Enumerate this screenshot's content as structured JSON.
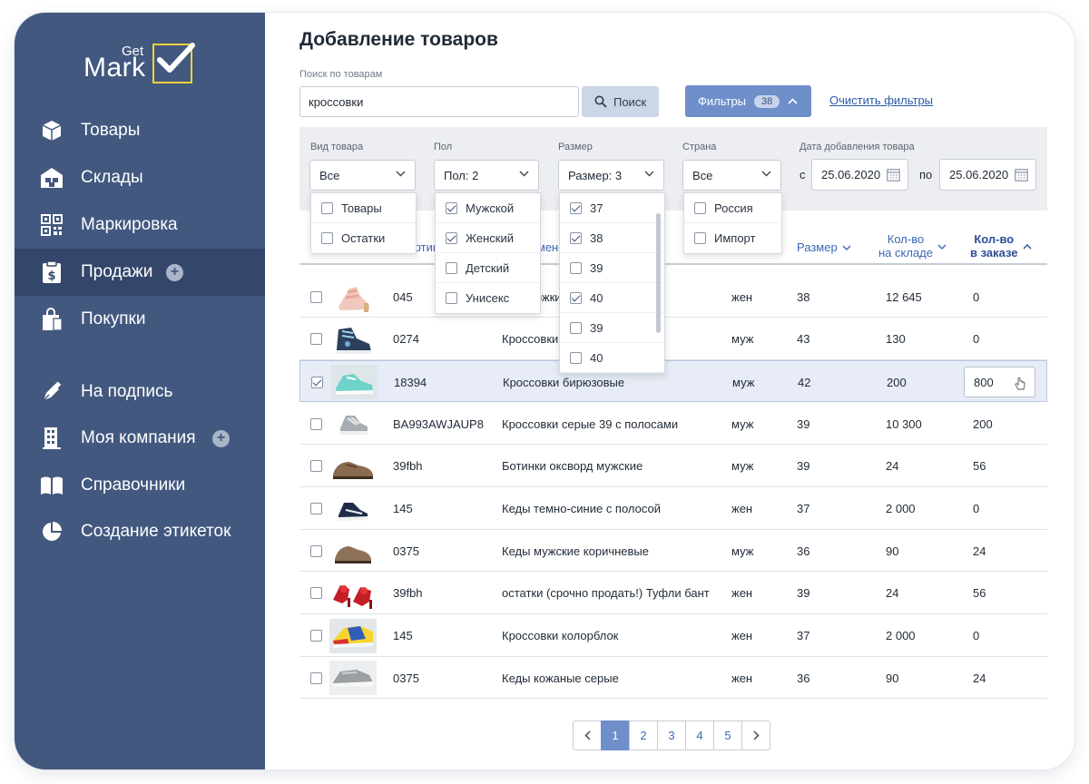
{
  "logo": {
    "get": "Get",
    "mark": "Mark"
  },
  "sidebar": {
    "items": [
      {
        "label": "Товары",
        "icon": "box-icon"
      },
      {
        "label": "Склады",
        "icon": "warehouse-icon"
      },
      {
        "label": "Маркировка",
        "icon": "qr-code-icon"
      },
      {
        "label": "Продажи",
        "icon": "receipt-dollar-icon",
        "active": true,
        "plus": "+"
      },
      {
        "label": "Покупки",
        "icon": "shopping-bag-icon"
      },
      {
        "label": "На подпись",
        "icon": "pen-icon"
      },
      {
        "label": "Моя компания",
        "icon": "building-icon",
        "plus": "+"
      },
      {
        "label": "Справочники",
        "icon": "book-icon"
      },
      {
        "label": "Создание этикеток",
        "icon": "pie-chart-icon"
      }
    ]
  },
  "page": {
    "title": "Добавление товаров"
  },
  "search": {
    "label": "Поиск по товарам",
    "value": "кроссовки",
    "button": "Поиск"
  },
  "filters": {
    "button": "Фильтры",
    "count": "38",
    "clear": "Очистить фильтры",
    "type": {
      "label": "Вид товара",
      "value": "Все",
      "options": [
        {
          "label": "Товары",
          "checked": false
        },
        {
          "label": "Остатки",
          "checked": false
        }
      ]
    },
    "gender": {
      "label": "Пол",
      "value": "Пол: 2",
      "options": [
        {
          "label": "Мужской",
          "checked": true
        },
        {
          "label": "Женский",
          "checked": true
        },
        {
          "label": "Детский",
          "checked": false
        },
        {
          "label": "Унисекс",
          "checked": false
        }
      ]
    },
    "size": {
      "label": "Размер",
      "value": "Размер: 3",
      "options": [
        {
          "label": "37",
          "checked": true
        },
        {
          "label": "38",
          "checked": true
        },
        {
          "label": "39",
          "checked": false
        },
        {
          "label": "40",
          "checked": true
        },
        {
          "label": "39",
          "checked": false
        },
        {
          "label": "40",
          "checked": false
        }
      ]
    },
    "country": {
      "label": "Страна",
      "value": "Все",
      "options": [
        {
          "label": "Россия",
          "checked": false
        },
        {
          "label": "Импорт",
          "checked": false
        }
      ]
    },
    "date": {
      "label": "Дата добавления товара",
      "from_label": "с",
      "from": "25.06.2020",
      "to_label": "по",
      "to": "25.06.2020"
    }
  },
  "table": {
    "headers": {
      "article": "Артикул",
      "name": "Наименование",
      "size": "Размер",
      "stock_1": "Кол-во",
      "stock_2": "на складе",
      "order_1": "Кол-во",
      "order_2": "в заказе"
    },
    "rows": [
      {
        "checked": false,
        "article": "045",
        "name": "Босоножки, ж,",
        "gender": "жен",
        "size": "38",
        "stock": "12 645",
        "order": "0",
        "shoe": "sandal"
      },
      {
        "checked": false,
        "article": "0274",
        "name": "Кроссовки",
        "gender": "муж",
        "size": "43",
        "stock": "130",
        "order": "0",
        "shoe": "hightop"
      },
      {
        "checked": true,
        "article": "18394",
        "name": "Кроссовки бирюзовые",
        "gender": "муж",
        "size": "42",
        "stock": "200",
        "order": "800",
        "shoe": "turquoise"
      },
      {
        "checked": false,
        "article": "BA993AWJAUP8",
        "name": "Кроссовки серые 39 с полосами",
        "gender": "муж",
        "size": "39",
        "stock": "10 300",
        "order": "200",
        "shoe": "gray"
      },
      {
        "checked": false,
        "article": "39fbh",
        "name": "Ботинки оксворд мужские",
        "gender": "муж",
        "size": "39",
        "stock": "24",
        "order": "56",
        "shoe": "oxford"
      },
      {
        "checked": false,
        "article": "145",
        "name": "Кеды темно-синие с полосой",
        "gender": "жен",
        "size": "37",
        "stock": "2 000",
        "order": "0",
        "shoe": "navy"
      },
      {
        "checked": false,
        "article": "0375",
        "name": "Кеды мужские коричневые",
        "gender": "муж",
        "size": "36",
        "stock": "90",
        "order": "24",
        "shoe": "brown"
      },
      {
        "checked": false,
        "article": "39fbh",
        "name": "остатки (срочно продать!) Туфли бант",
        "gender": "жен",
        "size": "39",
        "stock": "24",
        "order": "56",
        "shoe": "red"
      },
      {
        "checked": false,
        "article": "145",
        "name": "Кроссовки колорблок",
        "gender": "жен",
        "size": "37",
        "stock": "2 000",
        "order": "0",
        "shoe": "colorblock"
      },
      {
        "checked": false,
        "article": "0375",
        "name": "Кеды кожаные серые",
        "gender": "жен",
        "size": "36",
        "stock": "90",
        "order": "24",
        "shoe": "leather"
      }
    ]
  },
  "pagination": {
    "pages": [
      "1",
      "2",
      "3",
      "4",
      "5"
    ],
    "current": "1"
  },
  "colors": {
    "sidebar": "#42587f",
    "sidebar_active": "#34476a",
    "accent": "#6f8fca",
    "link": "#2d5aa7",
    "logo_box": "#f1d23a"
  }
}
